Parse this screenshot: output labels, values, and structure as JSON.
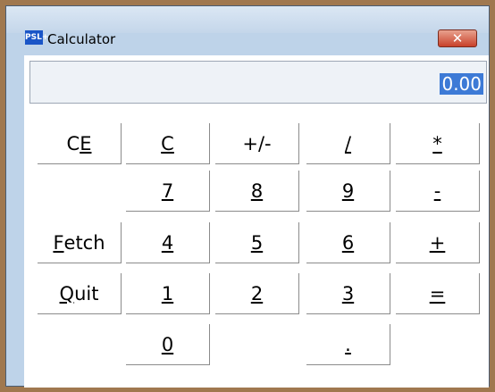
{
  "window": {
    "title": "Calculator",
    "app_icon_text": "PSL+",
    "close_symbol": "✕"
  },
  "display": {
    "value": "0.00"
  },
  "buttons": {
    "ce_prefix": "C",
    "ce_mnemonic": "E",
    "c": "C",
    "plus_minus": "+/-",
    "divide": "/",
    "multiply": "*",
    "seven": "7",
    "eight": "8",
    "nine": "9",
    "minus": "-",
    "fetch_mnemonic": "F",
    "fetch_rest": "etch",
    "four": "4",
    "five": "5",
    "six": "6",
    "plus": "+",
    "quit_mnemonic": "Q",
    "quit_rest": "uit",
    "one": "1",
    "two": "2",
    "three": "3",
    "equals": "=",
    "zero": "0",
    "decimal": "."
  }
}
